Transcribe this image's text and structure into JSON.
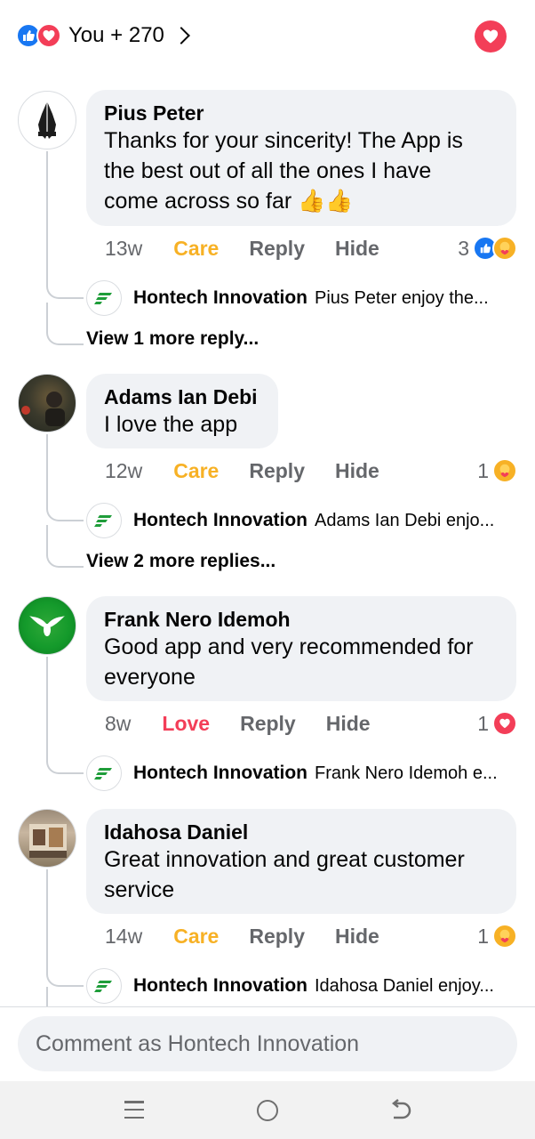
{
  "header": {
    "reaction_icons": [
      "like-icon",
      "love-icon"
    ],
    "reaction_count": "You + 270"
  },
  "comments": [
    {
      "name": "Pius Peter",
      "text_lines": [
        "Thanks for your sincerity! The App is",
        "the best out of all the ones I have",
        "come across so far 👍👍"
      ],
      "time": "13w",
      "my_reaction": "Care",
      "reply": "Reply",
      "hide": "Hide",
      "reaction_count": "3",
      "reaction_icons": [
        "like-icon",
        "care-icon"
      ],
      "page_reply": {
        "name": "Hontech Innovation",
        "text": "Pius Peter enjoy the..."
      },
      "view_more": "View 1 more reply..."
    },
    {
      "name": "Adams Ian Debi",
      "text_lines": [
        "I love the app"
      ],
      "time": "12w",
      "my_reaction": "Care",
      "reply": "Reply",
      "hide": "Hide",
      "reaction_count": "1",
      "reaction_icons": [
        "care-icon"
      ],
      "page_reply": {
        "name": "Hontech Innovation",
        "text": "Adams Ian Debi enjo..."
      },
      "view_more": "View 2 more replies..."
    },
    {
      "name": "Frank Nero Idemoh",
      "text_lines": [
        "Good app and very recommended for",
        "everyone"
      ],
      "time": "8w",
      "my_reaction": "Love",
      "reply": "Reply",
      "hide": "Hide",
      "reaction_count": "1",
      "reaction_icons": [
        "love-icon"
      ],
      "page_reply": {
        "name": "Hontech Innovation",
        "text": "Frank Nero Idemoh e..."
      }
    },
    {
      "name": "Idahosa Daniel",
      "text_lines": [
        "Great innovation and great customer",
        "service"
      ],
      "time": "14w",
      "my_reaction": "Care",
      "reply": "Reply",
      "hide": "Hide",
      "reaction_count": "1",
      "reaction_icons": [
        "care-icon"
      ],
      "page_reply": {
        "name": "Hontech Innovation",
        "text": "Idahosa Daniel enjoy..."
      }
    }
  ],
  "composer": {
    "placeholder": "Comment as Hontech Innovation"
  },
  "colors": {
    "like": "#1877f2",
    "love": "#f33e58",
    "care": "#f7b125",
    "bubble": "#f0f2f5",
    "meta": "#65676b"
  },
  "navbar": {
    "icons": [
      "menu-icon",
      "home-icon",
      "back-icon"
    ]
  }
}
